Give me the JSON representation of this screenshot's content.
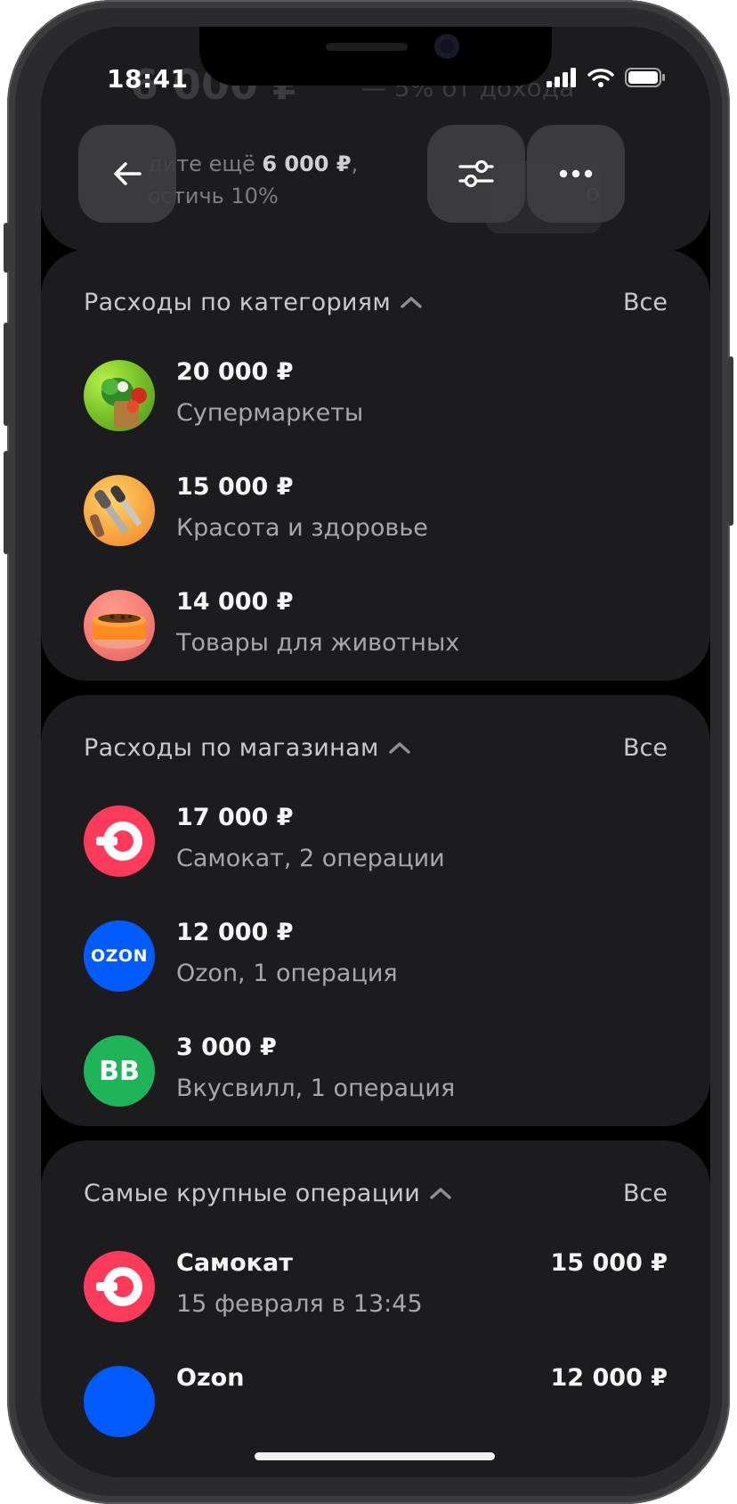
{
  "status_bar": {
    "time": "18:41"
  },
  "header_background": {
    "amount_partial": "6 000 ₽",
    "percent_partial": "—  5% от дохода",
    "hint_line1_prefix": "дите ещё ",
    "hint_line1_amount": "6 000 ₽",
    "hint_line1_suffix": ",",
    "hint_line2": "остичь 10%",
    "chip_partial": "о"
  },
  "categories": {
    "title": "Расходы по категориям",
    "all_label": "Все",
    "items": [
      {
        "amount": "20 000 ₽",
        "name": "Супермаркеты",
        "icon": "groceries-icon"
      },
      {
        "amount": "15 000 ₽",
        "name": "Красота и здоровье",
        "icon": "makeup-brushes-icon"
      },
      {
        "amount": "14 000 ₽",
        "name": "Товары для животных",
        "icon": "pet-bowl-icon"
      }
    ]
  },
  "stores": {
    "title": "Расходы по магазинам",
    "all_label": "Все",
    "items": [
      {
        "amount": "17 000 ₽",
        "name": "Самокат, 2 операции",
        "logo_color": "#ff3b5c"
      },
      {
        "amount": "12 000 ₽",
        "name": "Ozon, 1 операция",
        "logo_text": "OZON",
        "logo_color": "#005bff"
      },
      {
        "amount": "3 000 ₽",
        "name": "Вкусвилл, 1 операция",
        "logo_text": "BB",
        "logo_color": "#1fb35a"
      }
    ]
  },
  "largest": {
    "title": "Самые крупные операции",
    "all_label": "Все",
    "items": [
      {
        "name": "Самокат",
        "date": "15 февраля в 13:45",
        "amount": "15 000 ₽"
      },
      {
        "name": "Ozon",
        "date": "",
        "amount": "12 000 ₽"
      }
    ]
  }
}
